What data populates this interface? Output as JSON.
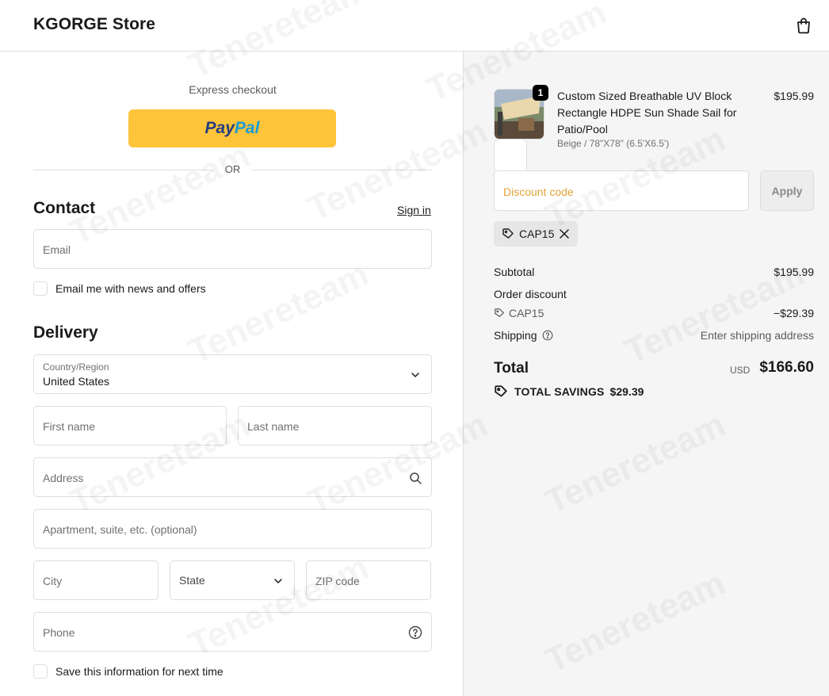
{
  "header": {
    "store_name": "KGORGE Store",
    "cart_icon": "shopping-bag-icon"
  },
  "express": {
    "label": "Express checkout",
    "paypal_a": "Pay",
    "paypal_b": "Pal",
    "or": "OR"
  },
  "contact": {
    "title": "Contact",
    "sign_in": "Sign in",
    "email_placeholder": "Email",
    "news_label": "Email me with news and offers"
  },
  "delivery": {
    "title": "Delivery",
    "country_label": "Country/Region",
    "country_value": "United States",
    "first_name": "First name",
    "last_name": "Last name",
    "address": "Address",
    "apartment": "Apartment, suite, etc. (optional)",
    "city": "City",
    "state": "State",
    "zip": "ZIP code",
    "phone": "Phone",
    "save_label": "Save this information for next time"
  },
  "order": {
    "quantity": "1",
    "product_name": "Custom Sized Breathable UV Block Rectangle HDPE Sun Shade Sail for Patio/Pool",
    "variant": "Beige / 78\"X78\" (6.5'X6.5')",
    "price": "$195.99",
    "discount_placeholder": "Discount code",
    "apply": "Apply",
    "applied_code": "CAP15",
    "subtotal_label": "Subtotal",
    "subtotal": "$195.99",
    "order_discount_label": "Order discount",
    "discount_code": "CAP15",
    "discount_amount": "−$29.39",
    "shipping_label": "Shipping",
    "shipping_value": "Enter shipping address",
    "total_label": "Total",
    "currency": "USD",
    "total": "$166.60",
    "savings_label": "TOTAL SAVINGS",
    "savings_amount": "$29.39"
  },
  "watermark": "Tenereteam",
  "colors": {
    "paypal": "#ffc439",
    "accent_placeholder": "#e2a43a"
  }
}
